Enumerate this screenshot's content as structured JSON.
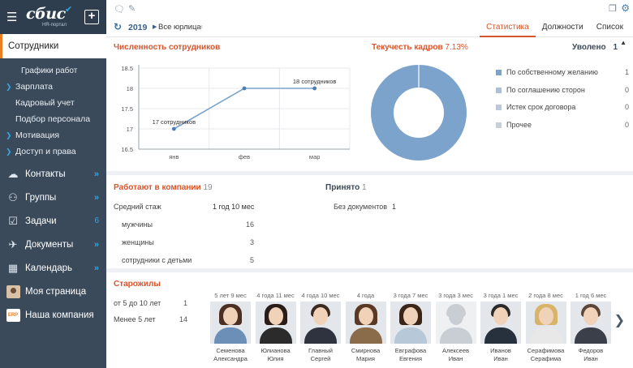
{
  "colors": {
    "accent": "#d9542a",
    "sidebar_bg": "#3b4a5b",
    "link": "#2fa7e2",
    "chart": "#7ba3cc"
  },
  "sidebar": {
    "brand": "сбис",
    "brand_sub": "HR-портал",
    "active": "Сотрудники",
    "sub_items": [
      "Графики работ"
    ],
    "groups": [
      {
        "label": "Зарплата",
        "arrow": true
      },
      {
        "label": "Кадровый учет",
        "arrow": false
      },
      {
        "label": "Подбор персонала",
        "arrow": false
      },
      {
        "label": "Мотивация",
        "arrow": true
      },
      {
        "label": "Доступ и права",
        "arrow": true
      }
    ],
    "main_items": [
      {
        "label": "Контакты",
        "icon": "cloud-icon",
        "glyph": "☁",
        "chev": "»",
        "count": ""
      },
      {
        "label": "Группы",
        "icon": "groups-icon",
        "glyph": "⚇",
        "chev": "»",
        "count": ""
      },
      {
        "label": "Задачи",
        "icon": "tasks-icon",
        "glyph": "☑",
        "chev": "",
        "count": "6"
      },
      {
        "label": "Документы",
        "icon": "send-icon",
        "glyph": "✈",
        "chev": "»",
        "count": ""
      },
      {
        "label": "Календарь",
        "icon": "calendar-icon",
        "glyph": "▦",
        "chev": "»",
        "count": ""
      },
      {
        "label": "Моя страница",
        "icon": "avatar-icon",
        "glyph": "",
        "chev": "",
        "count": ""
      },
      {
        "label": "Наша компания",
        "icon": "company-logo-icon",
        "glyph": "",
        "chev": "",
        "count": ""
      }
    ],
    "company_logo_text": "ERP"
  },
  "filter": {
    "year": "2019",
    "org": "Все юрлица"
  },
  "tabs": [
    "Статистика",
    "Должности",
    "Список"
  ],
  "headcount": {
    "title": "Численность сотрудников"
  },
  "chart_data": {
    "type": "line",
    "categories": [
      "янв",
      "фев",
      "мар"
    ],
    "values": [
      17,
      18,
      18
    ],
    "point_labels": [
      "17 сотрудников",
      "",
      "18 сотрудников"
    ],
    "ylim": [
      16.5,
      18.5
    ],
    "yticks": [
      "18.5",
      "18",
      "17.5",
      "17",
      "16.5"
    ],
    "grid": true
  },
  "turnover": {
    "title": "Текучесть кадров",
    "value": "7.13%",
    "dismissed_label": "Уволено",
    "dismissed_count": "1",
    "legend": [
      {
        "label": "По собственному желанию",
        "count": "1",
        "color": "#7ba3cc"
      },
      {
        "label": "По соглашению сторон",
        "count": "0",
        "color": "#a9c2dc"
      },
      {
        "label": "Истек срок договора",
        "count": "0",
        "color": "#b9c9d9"
      },
      {
        "label": "Прочее",
        "count": "0",
        "color": "#c7cfd8"
      }
    ]
  },
  "working": {
    "title": "Работают в компании",
    "count": "19",
    "avg_tenure_label": "Средний стаж",
    "avg_tenure": "1 год 10 мес",
    "rows": [
      {
        "label": "мужчины",
        "value": "16"
      },
      {
        "label": "женщины",
        "value": "3"
      },
      {
        "label": "сотрудники с детьми",
        "value": "5"
      }
    ]
  },
  "hired": {
    "title": "Принято",
    "count": "1",
    "row_label": "Без документов",
    "row_value": "1"
  },
  "oldtimers": {
    "title": "Старожилы",
    "groups": [
      {
        "label": "от 5 до 10 лет",
        "value": "1"
      },
      {
        "label": "Менее 5 лет",
        "value": "14"
      }
    ],
    "staff": [
      {
        "tenure": "5 лет 9 мес",
        "last": "Семенова",
        "first": "Александра",
        "gender": "f",
        "hair": "#4a2f22",
        "body": "#6b8fb7"
      },
      {
        "tenure": "4 года 11 мес",
        "last": "Юлианова",
        "first": "Юлия",
        "gender": "f",
        "hair": "#2a1d17",
        "body": "#2b2b2b"
      },
      {
        "tenure": "4 года 10 мес",
        "last": "Главный",
        "first": "Сергей",
        "gender": "m",
        "hair": "#3a2a20",
        "body": "#2f3340"
      },
      {
        "tenure": "4 года",
        "last": "Смирнова",
        "first": "Мария",
        "gender": "f",
        "hair": "#5a3a24",
        "body": "#8a6b4a"
      },
      {
        "tenure": "3 года 7 мес",
        "last": "Евграфова",
        "first": "Евгения",
        "gender": "f",
        "hair": "#3b2418",
        "body": "#b7c9d9"
      },
      {
        "tenure": "3 года 3 мес",
        "last": "Алексеев",
        "first": "Иван",
        "gender": "none",
        "hair": "#c9ced4",
        "body": "#c9ced4"
      },
      {
        "tenure": "3 года 1 мес",
        "last": "Иванов",
        "first": "Иван",
        "gender": "m",
        "hair": "#2a2a2a",
        "body": "#27303d"
      },
      {
        "tenure": "2 года 8 мес",
        "last": "Серафимова",
        "first": "Серафима",
        "gender": "f",
        "hair": "#d8b36a",
        "body": "#e8e8e8"
      },
      {
        "tenure": "1 год 6 мес",
        "last": "Федоров",
        "first": "Иван",
        "gender": "m",
        "hair": "#5a4638",
        "body": "#3a3f4a"
      }
    ]
  }
}
